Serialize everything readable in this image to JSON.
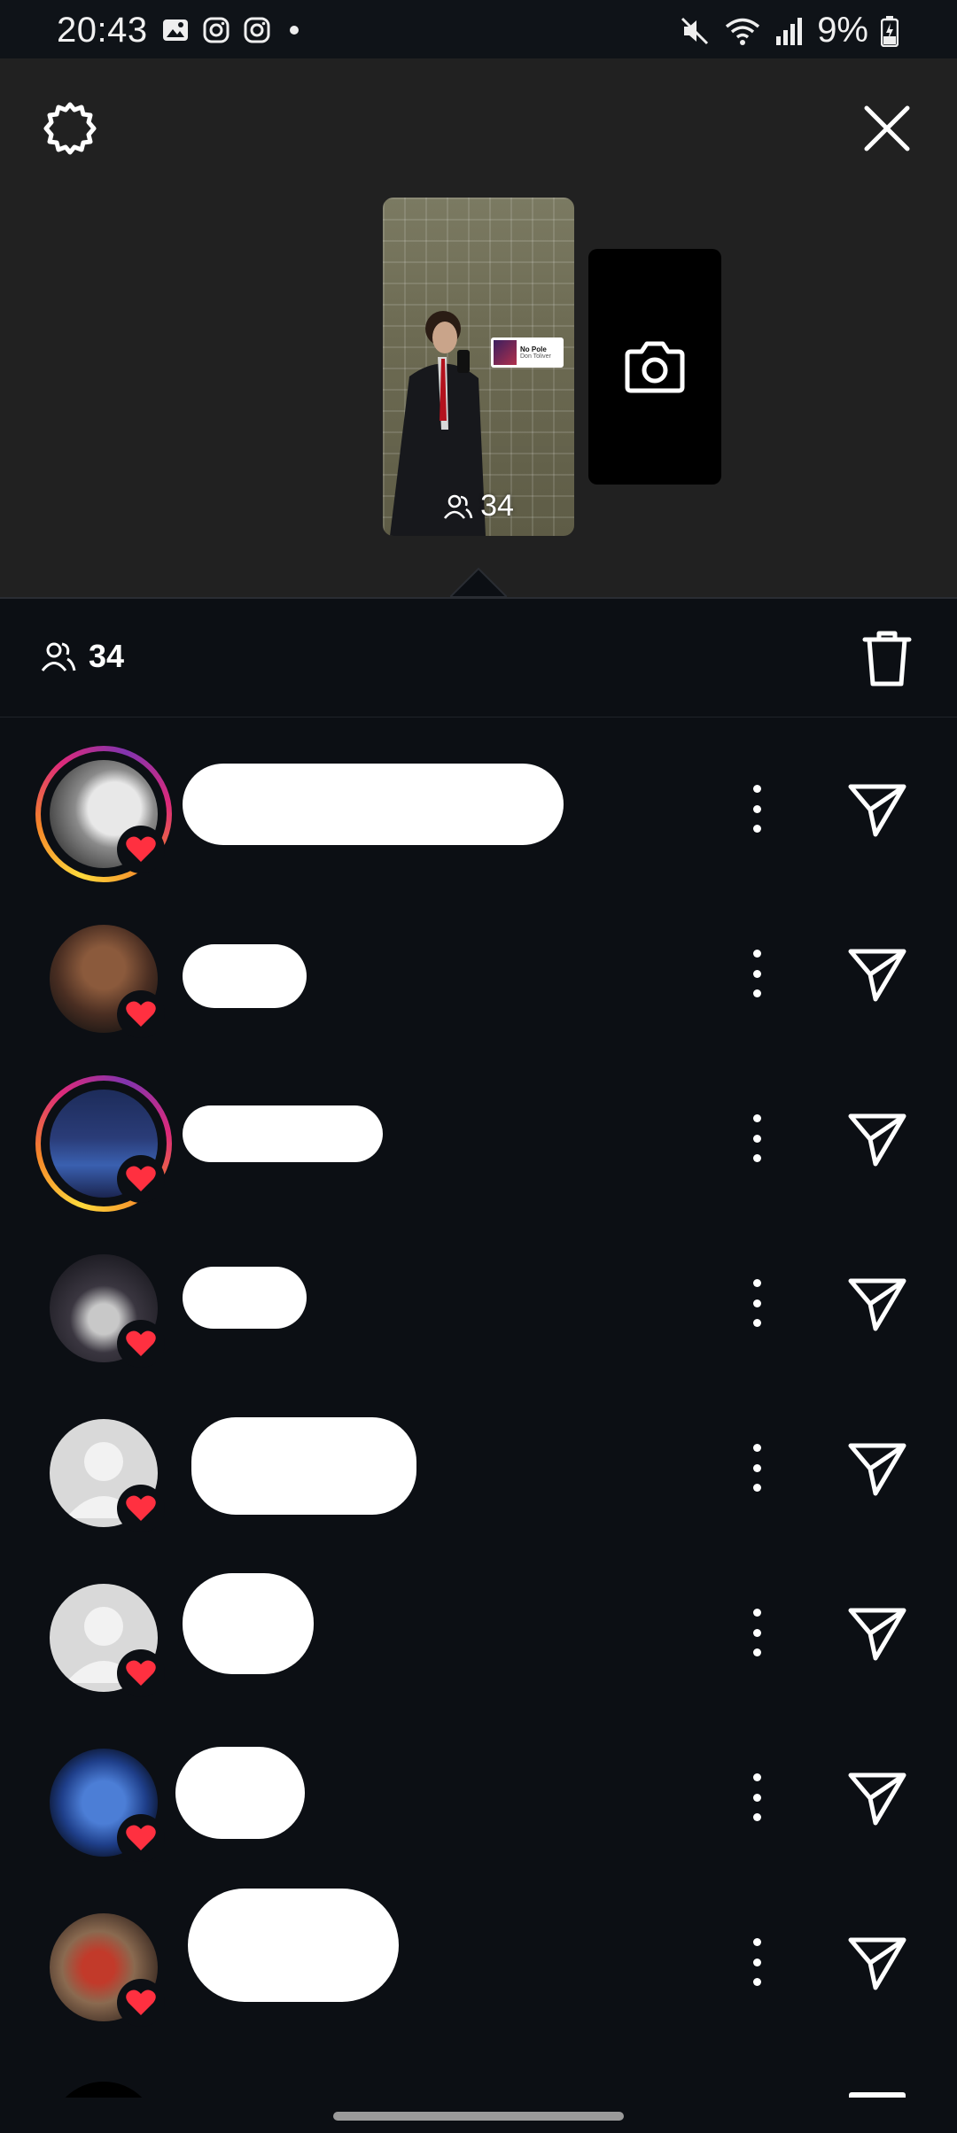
{
  "status_bar": {
    "time": "20:43",
    "battery_percent": "9%",
    "icons": [
      "image-icon",
      "instagram-icon",
      "instagram-icon",
      "dot-icon",
      "mute-icon",
      "wifi-icon",
      "signal-icon",
      "battery-charging-icon"
    ]
  },
  "header": {
    "settings_icon": "gear-icon",
    "close_icon": "close-icon"
  },
  "story": {
    "viewer_count": "34",
    "sticker": {
      "title": "No Pole",
      "artist": "Don Toliver"
    },
    "add_icon": "camera-icon"
  },
  "viewers_section": {
    "count": "34",
    "delete_icon": "trash-icon"
  },
  "viewers": [
    {
      "avatar": "white-horse-photo",
      "has_story_ring": true,
      "liked": true
    },
    {
      "avatar": "selfie-photo",
      "has_story_ring": false,
      "liked": true
    },
    {
      "avatar": "crowd-photo",
      "has_story_ring": true,
      "liked": true
    },
    {
      "avatar": "night-photo",
      "has_story_ring": false,
      "liked": true
    },
    {
      "avatar": "default-avatar",
      "has_story_ring": false,
      "liked": true
    },
    {
      "avatar": "default-avatar",
      "has_story_ring": false,
      "liked": true
    },
    {
      "avatar": "blue-face-art",
      "has_story_ring": false,
      "liked": true
    },
    {
      "avatar": "group-photo",
      "has_story_ring": false,
      "liked": true
    }
  ],
  "colors": {
    "preview_bg": "#212121",
    "list_bg": "#0c0f14",
    "heart": "#ff3040",
    "text": "#ffffff"
  }
}
